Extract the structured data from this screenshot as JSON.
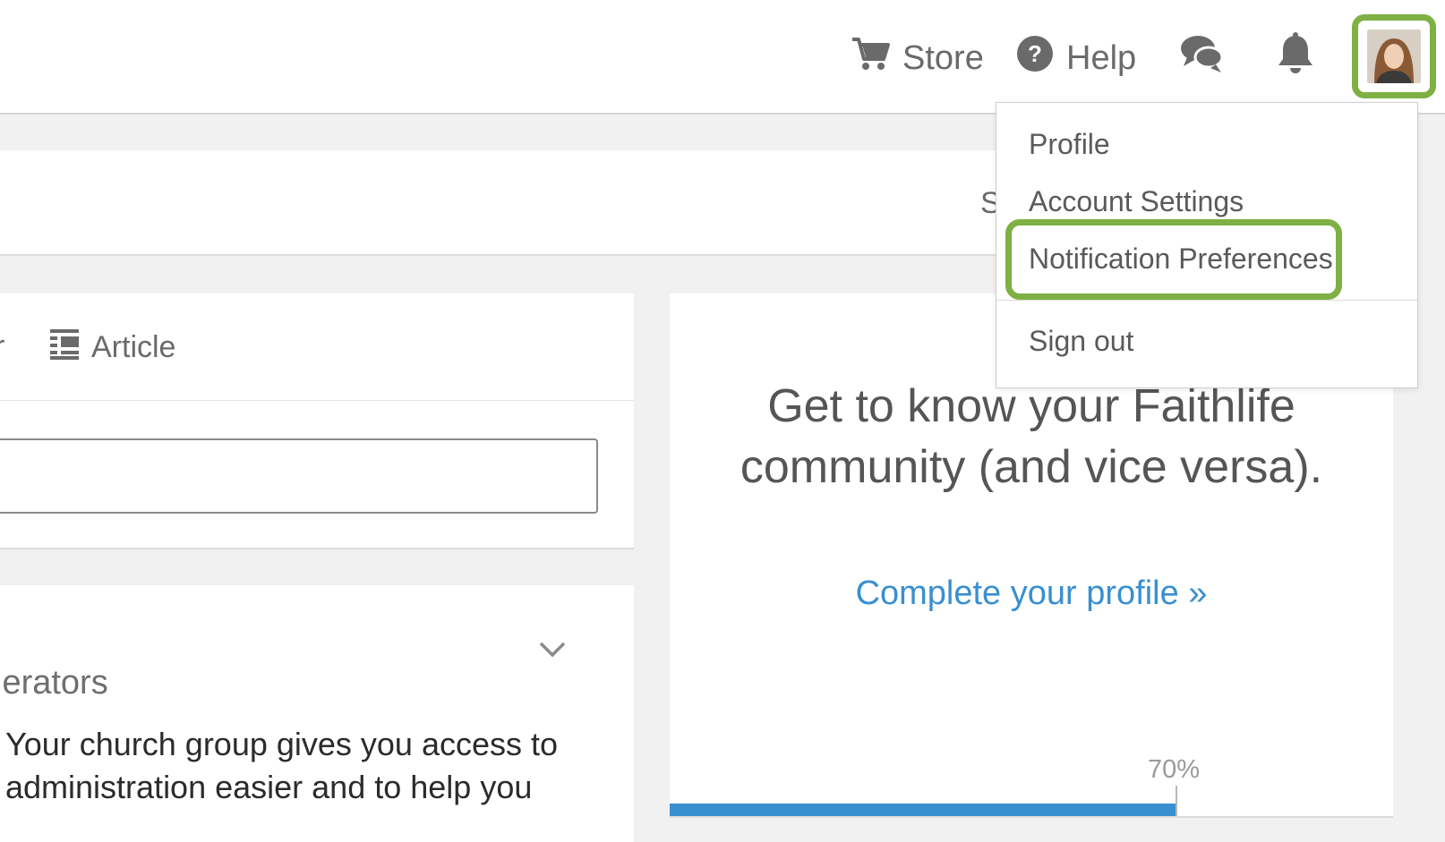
{
  "topbar": {
    "store_label": "Store",
    "help_label": "Help",
    "icons": [
      "cart-icon",
      "help-icon",
      "messages-icon",
      "bell-icon"
    ],
    "accent_highlight": "#7eb043"
  },
  "search_card": {
    "cut_text": "S"
  },
  "post_card": {
    "tab_fragment": "r",
    "article_tab_label": "Article"
  },
  "group_card": {
    "heading": "lerators",
    "body_line1": "Your church group gives you access to",
    "body_line2": "administration easier and to help you"
  },
  "promo_card": {
    "headline_line1": "Get to know your Faithlife",
    "headline_line2": "community (and vice versa).",
    "link_label": "Complete your profile »",
    "progress_label": "70%",
    "progress_value": 0.7,
    "link_color": "#3a8fd0"
  },
  "account_menu": {
    "items": [
      {
        "label": "Profile"
      },
      {
        "label": "Account Settings"
      },
      {
        "label": "Notification Preferences",
        "highlighted": true
      },
      {
        "label": "Sign out"
      }
    ]
  }
}
